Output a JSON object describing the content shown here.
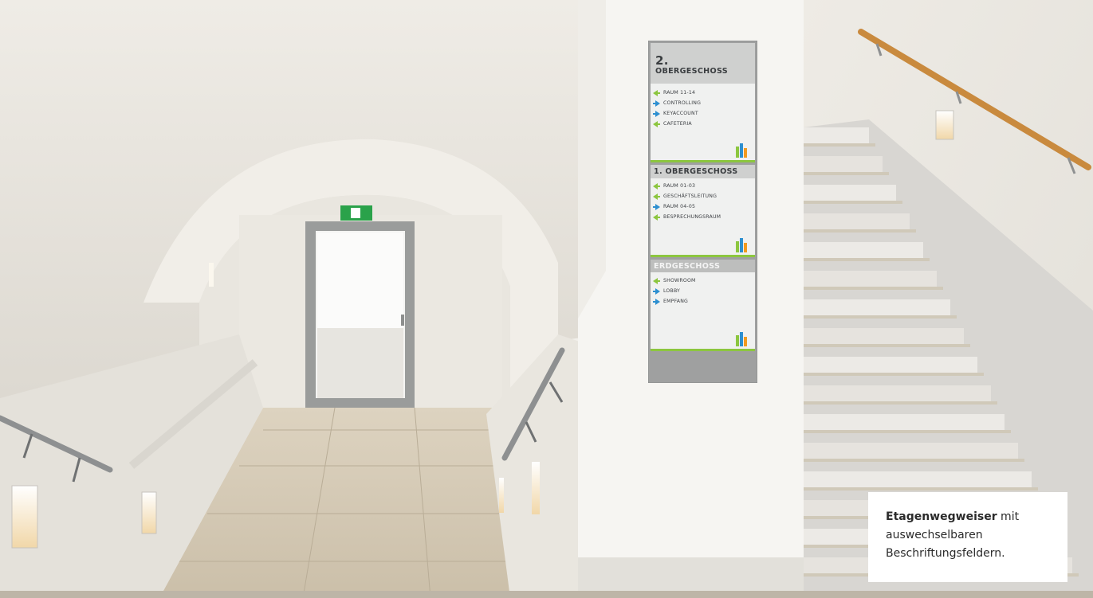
{
  "sign": {
    "panels": [
      {
        "heading_line1": "2.",
        "heading_line2": "OBERGESCHOSS",
        "rooms": [
          {
            "label": "RAUM 11-14",
            "arrow": "left-arrow-icon"
          },
          {
            "label": "CONTROLLING",
            "arrow": "right-arrow-icon"
          },
          {
            "label": "KEYACCOUNT",
            "arrow": "right-arrow-icon"
          },
          {
            "label": "CAFETERIA",
            "arrow": "left-arrow-icon"
          }
        ]
      },
      {
        "heading": "1. OBERGESCHOSS",
        "rooms": [
          {
            "label": "RAUM 01-03",
            "arrow": "left-arrow-icon"
          },
          {
            "label": "GESCHÄFTSLEITUNG",
            "arrow": "left-arrow-icon"
          },
          {
            "label": "RAUM 04-05",
            "arrow": "right-arrow-icon"
          },
          {
            "label": "BESPRECHUNGSRAUM",
            "arrow": "left-arrow-icon"
          }
        ]
      },
      {
        "heading": "ERDGESCHOSS",
        "rooms": [
          {
            "label": "SHOWROOM",
            "arrow": "left-arrow-icon"
          },
          {
            "label": "LOBBY",
            "arrow": "right-arrow-icon"
          },
          {
            "label": "EMPFANG",
            "arrow": "right-arrow-icon"
          }
        ]
      }
    ],
    "colors": {
      "green": "#8cc63f",
      "blue": "#2d8fd0",
      "orange": "#f39a1e",
      "plate": "#a7a8a8"
    }
  },
  "caption": {
    "bold": "Etagenwegweiser",
    "rest": " mit auswechselbaren Beschriftungsfeldern."
  }
}
